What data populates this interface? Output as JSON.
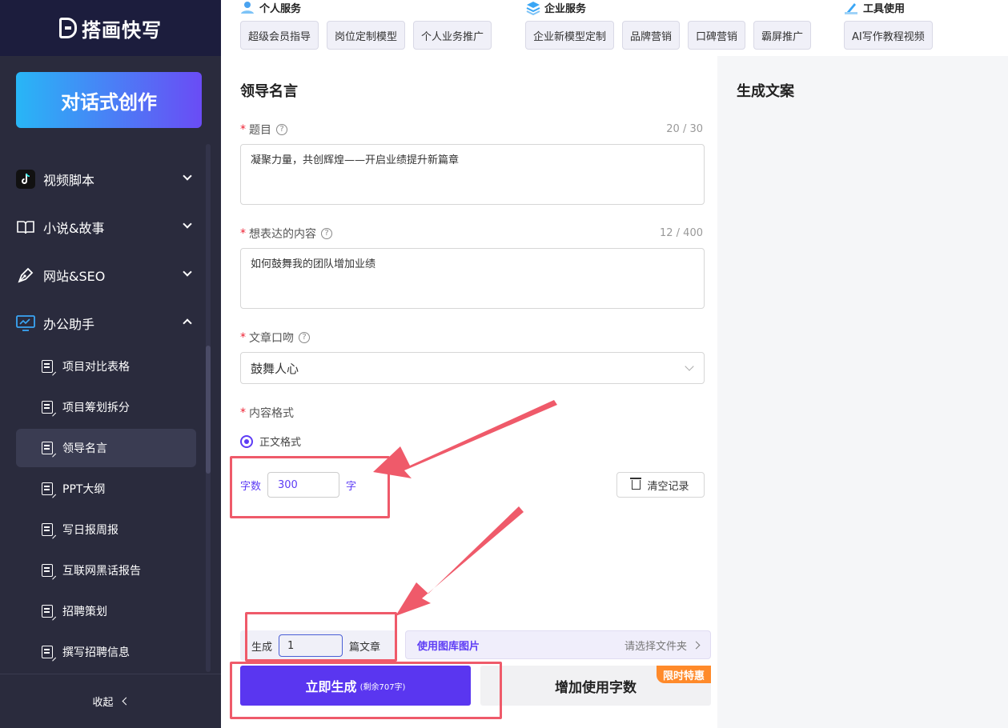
{
  "app": {
    "logo_text": "搭画快写"
  },
  "sidebar": {
    "create_button": "对话式创作",
    "menu": [
      {
        "label": "视频脚本",
        "icon": "tiktok-icon",
        "expanded": false
      },
      {
        "label": "小说&故事",
        "icon": "book-icon",
        "expanded": false
      },
      {
        "label": "网站&SEO",
        "icon": "pen-icon",
        "expanded": false
      },
      {
        "label": "办公助手",
        "icon": "monitor-chart-icon",
        "expanded": true
      }
    ],
    "sub_items": [
      {
        "label": "项目对比表格",
        "active": false
      },
      {
        "label": "项目筹划拆分",
        "active": false
      },
      {
        "label": "领导名言",
        "active": true
      },
      {
        "label": "PPT大纲",
        "active": false
      },
      {
        "label": "写日报周报",
        "active": false
      },
      {
        "label": "互联网黑话报告",
        "active": false
      },
      {
        "label": "招聘策划",
        "active": false
      },
      {
        "label": "撰写招聘信息",
        "active": false
      }
    ],
    "collapse_label": "收起"
  },
  "topbar": {
    "groups": [
      {
        "title": "个人服务",
        "icon": "user-service-icon",
        "tags": [
          "超级会员指导",
          "岗位定制模型",
          "个人业务推广"
        ]
      },
      {
        "title": "企业服务",
        "icon": "cube-stack-icon",
        "tags": [
          "企业新模型定制",
          "品牌营销",
          "口碑营销",
          "霸屏推广"
        ]
      },
      {
        "title": "工具使用",
        "icon": "tool-icon",
        "tags": [
          "AI写作教程视频"
        ]
      }
    ]
  },
  "form": {
    "title": "领导名言",
    "topic": {
      "label": "题目",
      "count": "20 / 30",
      "value": "凝聚力量，共创辉煌——开启业绩提升新篇章"
    },
    "content": {
      "label": "想表达的内容",
      "count": "12 / 400",
      "value": "如何鼓舞我的团队增加业绩"
    },
    "tone": {
      "label": "文章口吻",
      "value": "鼓舞人心"
    },
    "format": {
      "label": "内容格式",
      "option": "正文格式"
    },
    "word_count": {
      "prefix": "字数",
      "value": "300",
      "suffix": "字"
    },
    "clear_label": "清空记录",
    "generate": {
      "prefix": "生成",
      "value": "1",
      "suffix": "篇文章"
    },
    "gallery": {
      "label": "使用图库图片",
      "placeholder": "请选择文件夹"
    },
    "go_button": {
      "label": "立即生成",
      "note": "(剩余707字)"
    },
    "more_button": {
      "label": "增加使用字数",
      "badge": "限时特惠"
    }
  },
  "output": {
    "title": "生成文案"
  },
  "colors": {
    "accent": "#5a36f0",
    "annotation": "#ef5a6a",
    "sidebar": "#2a2b3d"
  }
}
